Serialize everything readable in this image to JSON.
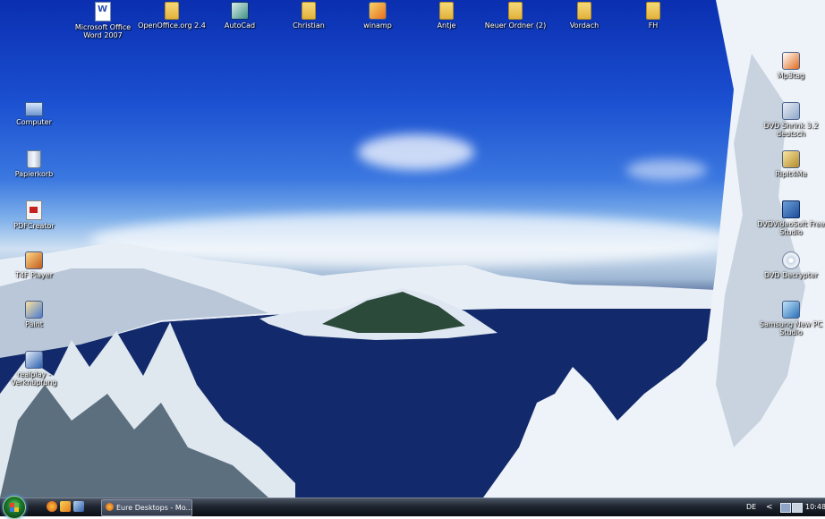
{
  "desktop": {
    "top_icons": [
      {
        "label": "Microsoft Office Word 2007",
        "icon": "word-document-icon"
      },
      {
        "label": "OpenOffice.org 2.4",
        "icon": "folder-icon"
      },
      {
        "label": "AutoCad",
        "icon": "autocad-icon"
      },
      {
        "label": "Christian",
        "icon": "folder-icon"
      },
      {
        "label": "winamp",
        "icon": "winamp-icon"
      },
      {
        "label": "Antje",
        "icon": "folder-icon"
      },
      {
        "label": "Neuer Ordner (2)",
        "icon": "folder-icon"
      },
      {
        "label": "Vordach",
        "icon": "folder-icon"
      },
      {
        "label": "FH",
        "icon": "folder-icon"
      }
    ],
    "left_icons": [
      {
        "label": "Computer",
        "icon": "computer-icon"
      },
      {
        "label": "Papierkorb",
        "icon": "recycle-bin-icon"
      },
      {
        "label": "PDFCreator",
        "icon": "pdf-icon"
      },
      {
        "label": "T4F Player",
        "icon": "player-icon"
      },
      {
        "label": "Paint",
        "icon": "paint-icon"
      },
      {
        "label": "realplay - Verknüpfung",
        "icon": "realplayer-icon"
      }
    ],
    "right_icons": [
      {
        "label": "Mp3tag",
        "icon": "mp3tag-icon"
      },
      {
        "label": "DVD Shrink 3.2 deutsch",
        "icon": "dvd-shrink-icon"
      },
      {
        "label": "RipIt4Me",
        "icon": "ripit-icon"
      },
      {
        "label": "DVDVideoSoft Free Studio",
        "icon": "dvdvideosoft-icon"
      },
      {
        "label": "DVD Decrypter",
        "icon": "dvd-decrypter-icon"
      },
      {
        "label": "Samsung New PC Studio",
        "icon": "samsung-pc-studio-icon"
      }
    ]
  },
  "taskbar": {
    "task_button_label": "Eure Desktops - Mo...",
    "language": "DE",
    "clock": "10:48",
    "chevron": "<"
  }
}
